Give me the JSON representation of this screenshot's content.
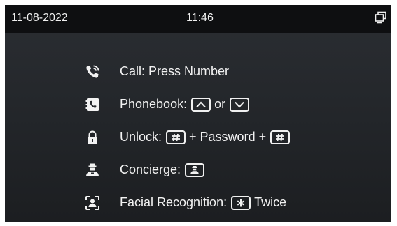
{
  "status_bar": {
    "date": "11-08-2022",
    "time": "11:46",
    "icon": "window-switch-icon"
  },
  "help": {
    "call": {
      "icon": "phone-call-icon",
      "label": "Call: Press Number"
    },
    "phonebook": {
      "icon": "phonebook-icon",
      "label": "Phonebook:",
      "key_up_icon": "arrow-up-key-icon",
      "or_text": "or",
      "key_down_icon": "arrow-down-key-icon"
    },
    "unlock": {
      "icon": "lock-icon",
      "label": "Unlock:",
      "key_hash_icon": "hash-key-icon",
      "plus_password": "+ Password +"
    },
    "concierge": {
      "icon": "concierge-icon",
      "label": "Concierge:",
      "key_icon": "concierge-key-icon"
    },
    "facial": {
      "icon": "face-scan-icon",
      "label": "Facial Recognition:",
      "key_star_icon": "star-key-icon",
      "twice_text": "Twice"
    }
  },
  "colors": {
    "status_bar_bg": "#0e0f11",
    "screen_bg_top": "#2b2e33",
    "screen_bg_bottom": "#1c1e21",
    "text": "#f2f2f2"
  }
}
